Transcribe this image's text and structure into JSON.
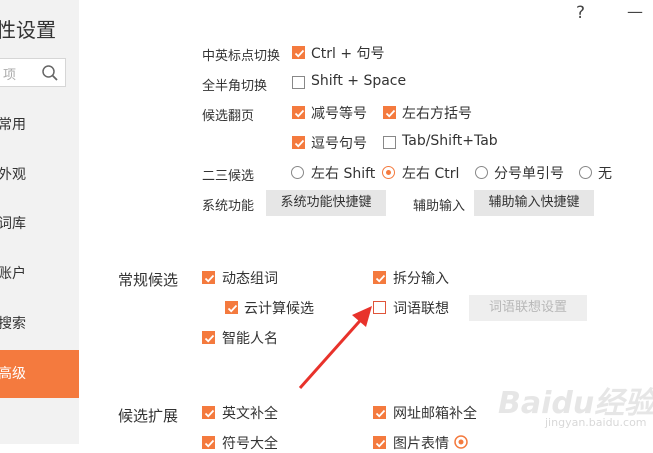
{
  "colors": {
    "accent": "#f47a3e",
    "arrow": "#e8322b"
  },
  "sidebar": {
    "title": "性设置",
    "search_placeholder": "项",
    "items": [
      {
        "label": "常用"
      },
      {
        "label": "外观"
      },
      {
        "label": "词库"
      },
      {
        "label": "账户"
      },
      {
        "label": "搜索"
      },
      {
        "label": "高级",
        "active": true
      }
    ]
  },
  "window": {
    "help_glyph": "?",
    "minimize_glyph": "—"
  },
  "hotkeys": {
    "cn_en_punct": {
      "label": "中英标点切换",
      "option": "Ctrl + 句号",
      "checked": true
    },
    "half_full": {
      "label": "全半角切换",
      "option": "Shift + Space",
      "checked": false
    },
    "page_turn": {
      "label": "候选翻页",
      "options": [
        {
          "text": "减号等号",
          "checked": true
        },
        {
          "text": "左右方括号",
          "checked": true
        },
        {
          "text": "逗号句号",
          "checked": true
        },
        {
          "text": "Tab/Shift+Tab",
          "checked": false
        }
      ]
    },
    "second_third": {
      "label": "二三候选",
      "options": [
        {
          "text": "左右 Shift",
          "selected": false
        },
        {
          "text": "左右 Ctrl",
          "selected": true
        },
        {
          "text": "分号单引号",
          "selected": false
        },
        {
          "text": "无",
          "selected": false
        }
      ]
    },
    "system": {
      "label": "系统功能",
      "button": "系统功能快捷键"
    },
    "assist": {
      "label": "辅助输入",
      "button": "辅助输入快捷键"
    }
  },
  "general": {
    "title": "常规候选",
    "options": [
      {
        "text": "动态组词",
        "checked": true
      },
      {
        "text": "拆分输入",
        "checked": true
      },
      {
        "text": "云计算候选",
        "checked": true
      },
      {
        "text": "词语联想",
        "checked": false
      },
      {
        "text": "智能人名",
        "checked": true
      }
    ],
    "assoc_settings_button": "词语联想设置"
  },
  "extension": {
    "title": "候选扩展",
    "options": [
      {
        "text": "英文补全",
        "checked": true
      },
      {
        "text": "网址邮箱补全",
        "checked": true
      },
      {
        "text": "符号大全",
        "checked": true
      },
      {
        "text": "图片表情",
        "checked": true
      }
    ]
  },
  "watermark": {
    "text": "Baidu经验",
    "sub": "jingyan.baidu.com"
  }
}
